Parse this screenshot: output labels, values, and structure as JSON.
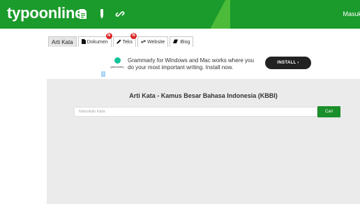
{
  "header": {
    "logo_text": "typoonline",
    "login_label": "Masuk",
    "colors": {
      "primary": "#1a9b2b",
      "accent": "#4cbb3a"
    },
    "icons": [
      "document-icon",
      "pen-icon",
      "link-icon"
    ]
  },
  "tabs": [
    {
      "label": "Arti Kata",
      "icon": "",
      "badge": "",
      "active": true
    },
    {
      "label": "Dokumen",
      "icon": "document-icon",
      "badge": "N",
      "active": false
    },
    {
      "label": "Teks",
      "icon": "pencil-icon",
      "badge": "N",
      "active": false
    },
    {
      "label": "Website",
      "icon": "link-icon",
      "badge": "",
      "active": false
    },
    {
      "label": "Blog",
      "icon": "blog-icon",
      "badge": "",
      "active": false
    }
  ],
  "ad": {
    "brand": "grammarly",
    "text": "Grammarly for Windows and Mac works where you do your most important writing. Install now.",
    "button_label": "INSTALL  ›",
    "info_label": "i"
  },
  "main": {
    "title": "Arti Kata - Kamus Besar Bahasa Indonesia (KBBI)",
    "search_placeholder": "Masukan kata",
    "search_value": "",
    "search_button": "Cari"
  }
}
